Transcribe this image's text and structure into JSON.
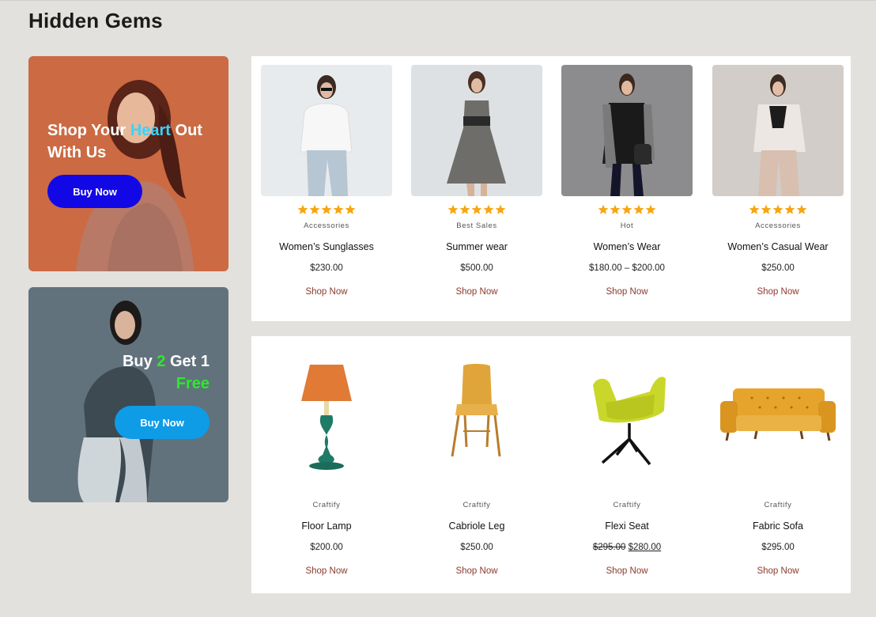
{
  "page": {
    "title": "Hidden Gems"
  },
  "promos": [
    {
      "line1_pre": "Shop Your ",
      "line1_highlight": "Heart",
      "line1_post": " Out",
      "line2": "With Us",
      "button": "Buy Now",
      "bg": "#cc6a43",
      "highlight_color": "#3ad3ff",
      "button_color": "#1208e6"
    },
    {
      "line1_pre": "Buy ",
      "line1_highlight": "2",
      "line1_post": " Get 1",
      "line2": "Free",
      "button": "Buy Now",
      "bg": "#62727d",
      "highlight_color": "#2bea2b",
      "button_color": "#0e9ce6"
    }
  ],
  "fashion": [
    {
      "category": "Accessories",
      "name": "Women’s Sunglasses",
      "price": "$230.00",
      "action": "Shop Now",
      "rating": 5,
      "icon": "woman-white-sweater-photo"
    },
    {
      "category": "Best Sales",
      "name": "Summer wear",
      "price": "$500.00",
      "action": "Shop Now",
      "rating": 5,
      "icon": "woman-grey-dress-photo"
    },
    {
      "category": "Hot",
      "name": "Women’s Wear",
      "price": "$180.00 – $200.00",
      "action": "Shop Now",
      "rating": 5,
      "icon": "woman-black-dress-photo"
    },
    {
      "category": "Accessories",
      "name": "Women’s Casual Wear",
      "price": "$250.00",
      "action": "Shop Now",
      "rating": 5,
      "icon": "woman-beige-suit-photo"
    }
  ],
  "furniture": [
    {
      "category": "Craftify",
      "name": "Floor Lamp",
      "price": "$200.00",
      "action": "Shop Now",
      "icon": "lamp-photo"
    },
    {
      "category": "Craftify",
      "name": "Cabriole Leg",
      "price": "$250.00",
      "action": "Shop Now",
      "icon": "chair-photo"
    },
    {
      "category": "Craftify",
      "name": "Flexi Seat",
      "price_old": "$295.00",
      "price_new": "$280.00",
      "action": "Shop Now",
      "icon": "lounge-chair-photo"
    },
    {
      "category": "Craftify",
      "name": "Fabric Sofa",
      "price": "$295.00",
      "action": "Shop Now",
      "icon": "sofa-photo"
    }
  ],
  "colors": {
    "star": "#f7a511",
    "shop_link": "#8a3a2e"
  }
}
